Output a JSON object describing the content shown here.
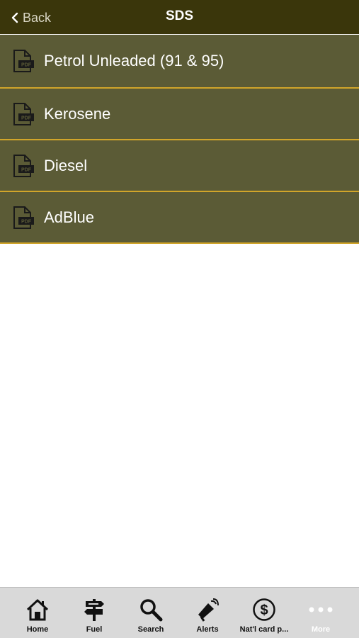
{
  "header": {
    "back_label": "Back",
    "title": "SDS"
  },
  "list": {
    "items": [
      {
        "label": "Petrol Unleaded (91 & 95)",
        "icon": "pdf-icon"
      },
      {
        "label": "Kerosene",
        "icon": "pdf-icon"
      },
      {
        "label": "Diesel",
        "icon": "pdf-icon"
      },
      {
        "label": "AdBlue",
        "icon": "pdf-icon"
      }
    ]
  },
  "tabbar": {
    "tabs": [
      {
        "label": "Home",
        "icon": "home-icon"
      },
      {
        "label": "Fuel",
        "icon": "signpost-icon"
      },
      {
        "label": "Search",
        "icon": "search-icon"
      },
      {
        "label": "Alerts",
        "icon": "megaphone-icon"
      },
      {
        "label": "Nat'l card p...",
        "icon": "dollar-icon"
      },
      {
        "label": "More",
        "icon": "more-dots-icon"
      }
    ]
  },
  "colors": {
    "nav_background": "#3a360b",
    "list_item_background": "#5b5b36",
    "list_divider": "#d1a52a",
    "tabbar_background": "#d9d9d9"
  }
}
